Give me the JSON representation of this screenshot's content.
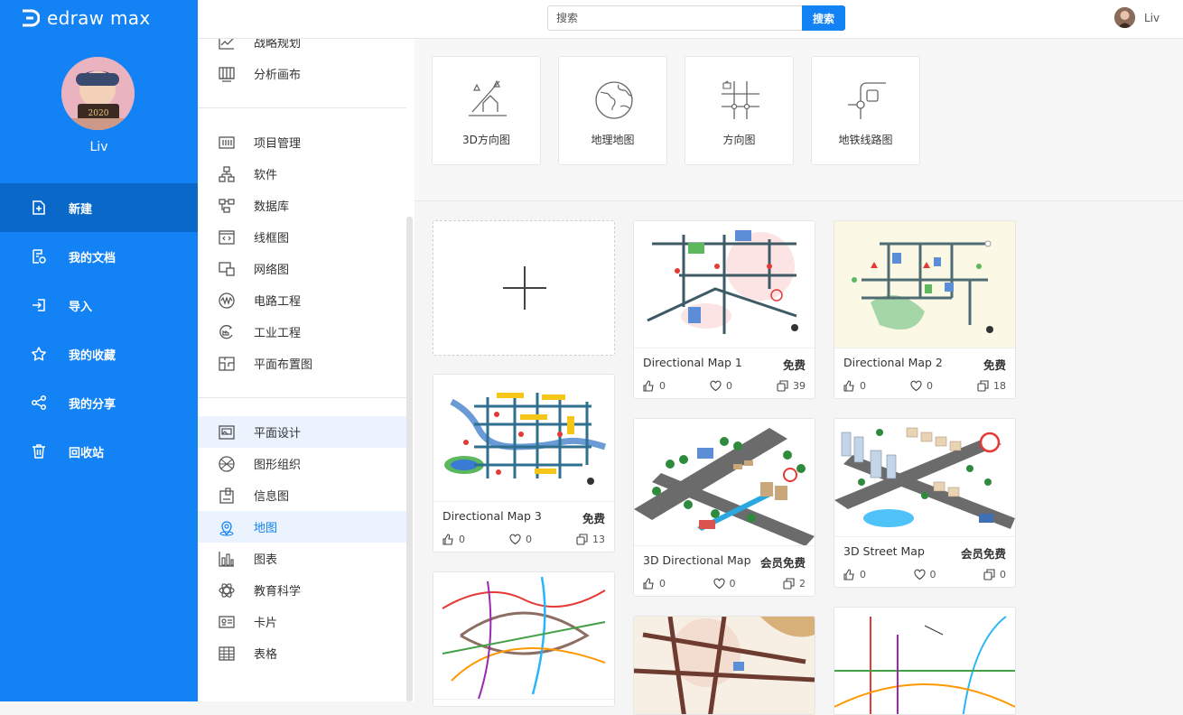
{
  "app": {
    "name": "edraw max"
  },
  "user": {
    "name": "Liv"
  },
  "nav": [
    {
      "label": "新建",
      "icon": "new-file-icon"
    },
    {
      "label": "我的文档",
      "icon": "my-docs-icon"
    },
    {
      "label": "导入",
      "icon": "import-icon"
    },
    {
      "label": "我的收藏",
      "icon": "star-icon"
    },
    {
      "label": "我的分享",
      "icon": "share-icon"
    },
    {
      "label": "回收站",
      "icon": "trash-icon"
    }
  ],
  "search": {
    "placeholder": "搜索",
    "button": "搜索"
  },
  "categories": {
    "group1": [
      {
        "label": "战略规划",
        "icon": "strategy-icon"
      },
      {
        "label": "分析画布",
        "icon": "canvas-icon"
      }
    ],
    "group2": [
      {
        "label": "项目管理",
        "icon": "project-icon"
      },
      {
        "label": "软件",
        "icon": "software-icon"
      },
      {
        "label": "数据库",
        "icon": "database-icon"
      },
      {
        "label": "线框图",
        "icon": "wireframe-icon"
      },
      {
        "label": "网络图",
        "icon": "network-icon"
      },
      {
        "label": "电路工程",
        "icon": "circuit-icon"
      },
      {
        "label": "工业工程",
        "icon": "industry-icon"
      },
      {
        "label": "平面布置图",
        "icon": "floorplan-icon"
      }
    ],
    "group3": [
      {
        "label": "平面设计",
        "icon": "graphic-design-icon"
      },
      {
        "label": "图形组织",
        "icon": "graphic-organizer-icon"
      },
      {
        "label": "信息图",
        "icon": "infographic-icon"
      },
      {
        "label": "地图",
        "icon": "map-pin-icon"
      },
      {
        "label": "图表",
        "icon": "chart-icon"
      },
      {
        "label": "教育科学",
        "icon": "atom-icon"
      },
      {
        "label": "卡片",
        "icon": "card-icon"
      },
      {
        "label": "表格",
        "icon": "table-icon"
      }
    ]
  },
  "subcategories": [
    {
      "label": "3D方向图",
      "icon": "3d-direction-icon"
    },
    {
      "label": "地理地图",
      "icon": "globe-icon"
    },
    {
      "label": "方向图",
      "icon": "direction-map-icon"
    },
    {
      "label": "地铁线路图",
      "icon": "subway-icon"
    }
  ],
  "templates": [
    {
      "title": "Directional Map 1",
      "tag": "免费",
      "likes": "0",
      "favs": "0",
      "copies": "39"
    },
    {
      "title": "Directional Map 2",
      "tag": "免费",
      "likes": "0",
      "favs": "0",
      "copies": "18"
    },
    {
      "title": "Directional Map 3",
      "tag": "免费",
      "likes": "0",
      "favs": "0",
      "copies": "13"
    },
    {
      "title": "3D Directional Map",
      "tag": "会员免费",
      "likes": "0",
      "favs": "0",
      "copies": "2"
    },
    {
      "title": "3D Street Map",
      "tag": "会员免费",
      "likes": "0",
      "favs": "0",
      "copies": "0"
    }
  ],
  "colors": {
    "brand": "#1282f4",
    "nav_active": "#0a68c9",
    "highlight": "#eaf3fe"
  }
}
